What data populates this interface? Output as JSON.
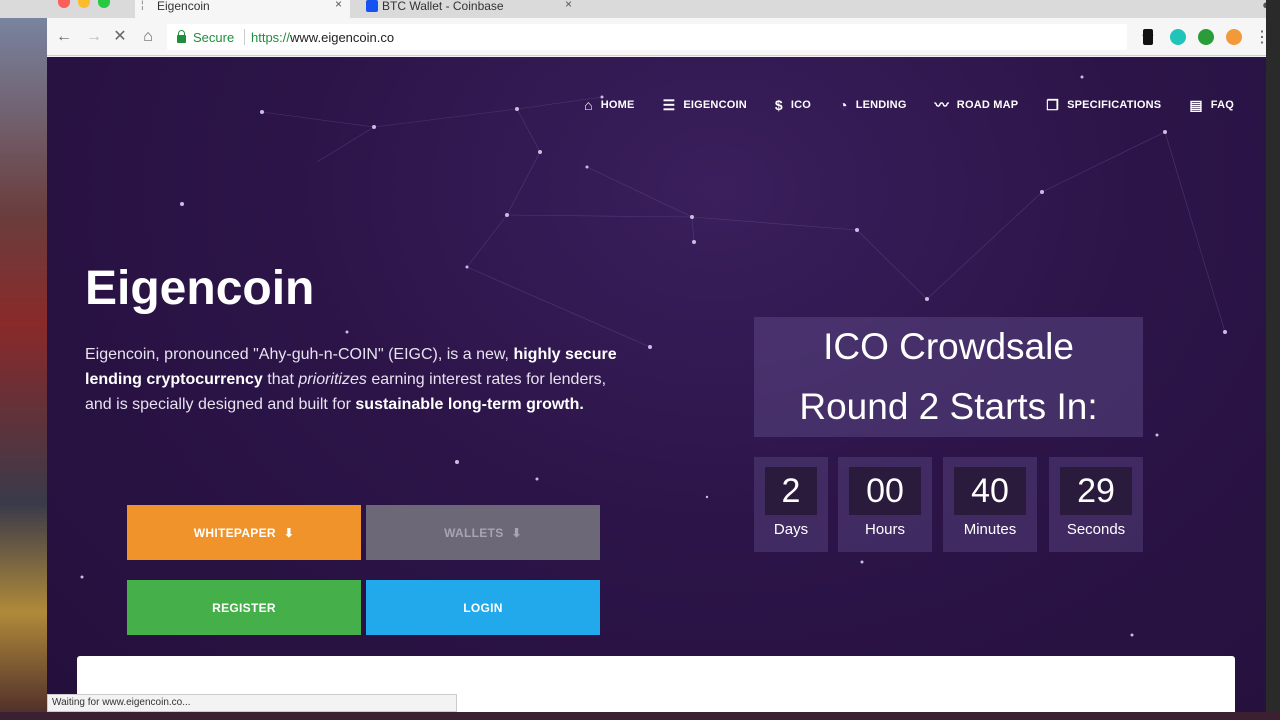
{
  "tabs": [
    {
      "title": "Eigencoin"
    },
    {
      "title": "BTC Wallet - Coinbase"
    }
  ],
  "address_bar": {
    "secure_label": "Secure",
    "url_scheme": "https://",
    "url_host": "www.eigencoin.co"
  },
  "nav": {
    "items": [
      {
        "label": "HOME",
        "icon": "home-icon"
      },
      {
        "label": "EIGENCOIN",
        "icon": "list-icon"
      },
      {
        "label": "ICO",
        "icon": "dollar-icon"
      },
      {
        "label": "LENDING",
        "icon": "chart-pie-icon"
      },
      {
        "label": "ROAD MAP",
        "icon": "trend-line-icon"
      },
      {
        "label": "SPECIFICATIONS",
        "icon": "copy-icon"
      },
      {
        "label": "FAQ",
        "icon": "chat-icon"
      }
    ]
  },
  "hero": {
    "title": "Eigencoin",
    "desc_1": "Eigencoin, pronounced \"Ahy-guh-n-COIN\" (EIGC), is a new, ",
    "desc_bold_1": "highly secure lending cryptocurrency",
    "desc_2": " that ",
    "desc_italic": "prioritizes",
    "desc_3": " earning interest rates for lenders, and is specially designed and built for ",
    "desc_bold_2": "sustainable long-term growth."
  },
  "buttons": {
    "whitepaper": "WHITEPAPER",
    "wallets": "WALLETS",
    "register": "REGISTER",
    "login": "LOGIN"
  },
  "countdown": {
    "heading_line1": "ICO Crowdsale",
    "heading_line2": "Round 2 Starts In:",
    "days": {
      "value": "2",
      "label": "Days"
    },
    "hours": {
      "value": "00",
      "label": "Hours"
    },
    "minutes": {
      "value": "40",
      "label": "Minutes"
    },
    "seconds": {
      "value": "29",
      "label": "Seconds"
    }
  },
  "status_text": "Waiting for www.eigencoin.co...",
  "colors": {
    "page_bg": "#2c1448",
    "whitepaper": "#f0932b",
    "wallets": "#6c6878",
    "register": "#45b049",
    "login": "#22a9ec",
    "secure_green": "#1e8e3e"
  }
}
